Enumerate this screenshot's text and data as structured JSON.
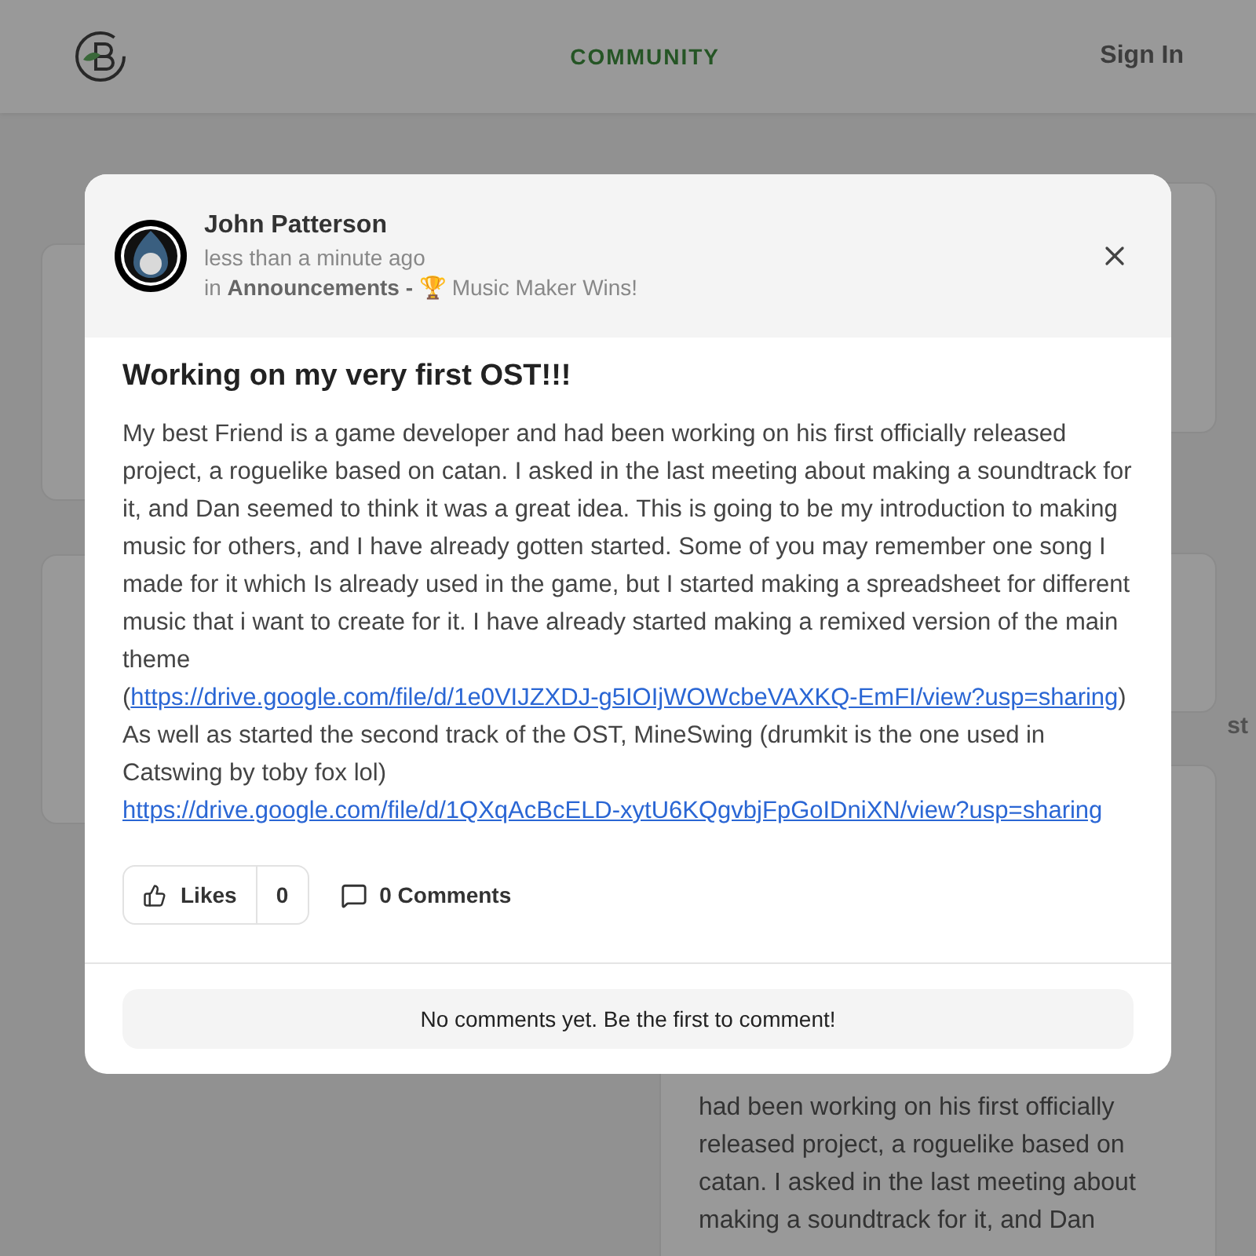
{
  "header": {
    "nav_link": "COMMUNITY",
    "sign_in": "Sign In"
  },
  "background": {
    "left_cards": [
      {
        "kind": "card"
      },
      {
        "kind": "card"
      }
    ],
    "right_heading": "st",
    "excerpt": "had been working on his first officially released project, a roguelike based on catan. I asked in the last meeting about making a soundtrack for it, and Dan"
  },
  "post": {
    "author": "John Patterson",
    "time": "less than a minute ago",
    "in_label": "in",
    "category": "Announcements",
    "separator": "-",
    "trophy": "🏆",
    "group": "Music Maker Wins!",
    "title": "Working on my very first OST!!!",
    "body": [
      {
        "kind": "text",
        "text": "My best Friend is a game developer and had been working on his first officially released project, a roguelike based on catan. I asked in the last meeting about making a soundtrack for it, and Dan seemed to think it was a great idea. This is going to be my introduction to making music for others, and I have already gotten started. Some of you may remember one song I made for it which Is already used in the game, but I started making a spreadsheet for different music that i want to create for it. I have already started making a remixed version of the main theme ("
      },
      {
        "kind": "link",
        "text": "https://drive.google.com/file/d/1e0VIJZXDJ-g5IOIjWOWcbeVAXKQ-EmFI/view?usp=sharing"
      },
      {
        "kind": "text",
        "text": ") As well as started the second track of the OST, MineSwing (drumkit is the one used in Catswing by toby fox lol) "
      },
      {
        "kind": "link",
        "text": "https://drive.google.com/file/d/1QXqAcBcELD-xytU6KQgvbjFpGoIDniXN/view?usp=sharing"
      }
    ],
    "likes_label": "Likes",
    "likes_count": "0",
    "comments_label": "0 Comments",
    "empty_comments": "No comments yet. Be the first to comment!"
  }
}
